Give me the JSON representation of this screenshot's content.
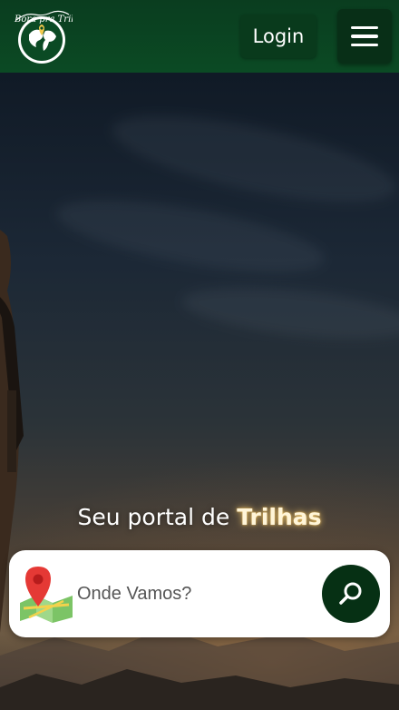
{
  "header": {
    "logo": {
      "text": "Bora pra Trilha",
      "icon": "globe-logo"
    },
    "login_label": "Login",
    "menu_icon": "hamburger-menu-icon"
  },
  "hero": {
    "tagline_prefix": "Seu portal de ",
    "tagline_highlight": "Trilhas"
  },
  "search": {
    "placeholder": "Onde Vamos?",
    "value": "",
    "map_icon": "map-pin-icon",
    "button_icon": "search-icon"
  },
  "colors": {
    "header_green": "#0b4a24",
    "button_green": "#063014",
    "highlight_glow": "#ffd26e"
  }
}
